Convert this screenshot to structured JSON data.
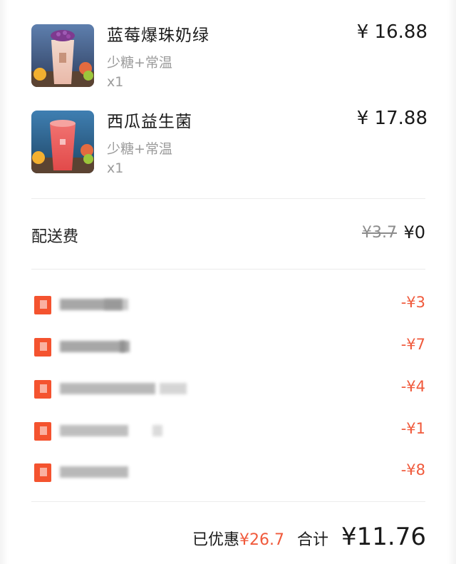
{
  "items": [
    {
      "name": "蓝莓爆珠奶绿",
      "spec": "少糖+常温",
      "qty": "x1",
      "price": "¥ 16.88"
    },
    {
      "name": "西瓜益生菌",
      "spec": "少糖+常温",
      "qty": "x1",
      "price": "¥ 17.88"
    }
  ],
  "delivery": {
    "label": "配送费",
    "original": "¥3.7",
    "price": "¥0"
  },
  "discounts": [
    {
      "amount": "-¥3"
    },
    {
      "amount": "-¥7"
    },
    {
      "amount": "-¥4"
    },
    {
      "amount": "-¥1"
    },
    {
      "amount": "-¥8"
    }
  ],
  "summary": {
    "discount_label": "已优惠",
    "discount_value": "¥26.7",
    "total_label": "合计",
    "total_value": "¥11.76"
  },
  "colors": {
    "accent": "#f05a3c",
    "discount_icon": "#f4532f",
    "muted": "#9b9b9b"
  }
}
